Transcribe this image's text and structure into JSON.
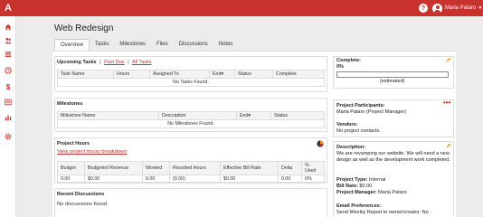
{
  "user": {
    "name": "Maria Pataro"
  },
  "page": {
    "title": "Web Redesign"
  },
  "tabs": [
    {
      "label": "Overview"
    },
    {
      "label": "Tasks"
    },
    {
      "label": "Milestones"
    },
    {
      "label": "Files"
    },
    {
      "label": "Discussions"
    },
    {
      "label": "Notes"
    }
  ],
  "upcoming": {
    "title": "Upcoming Tasks",
    "links": [
      "Past Due",
      "All Tasks"
    ],
    "columns": [
      "Task Name",
      "Hours",
      "Assigned To",
      "End▾",
      "Status",
      "Complete"
    ],
    "empty": "No Tasks Found."
  },
  "milestones": {
    "title": "Milestones",
    "columns": [
      "Milestone Name",
      "Description",
      "End▾",
      "Status"
    ],
    "empty": "No Milestones Found."
  },
  "hours": {
    "title": "Project Hours",
    "link": "View project hours breakdown",
    "columns": [
      "Budget",
      "Budgeted Revenue",
      "Worked",
      "Recoded Hours",
      "Effective Bill Rate",
      "Delta",
      "% Used"
    ],
    "row": [
      "0.00",
      "$0.00",
      "0.00",
      "(0.00)",
      "$0.00",
      "0.00",
      "0%"
    ]
  },
  "discussions": {
    "title": "Recent Discussions",
    "empty": "No discussions found."
  },
  "right": {
    "complete_label": "Complete:",
    "complete_value": "0%",
    "progress_fraction": 0,
    "estimated": "(estimated)",
    "participants_label": "Project Participants:",
    "participants_value": "Maria Pataro (Project Manager)",
    "vendors_label": "Vendors:",
    "vendors_value": "No project contacts.",
    "description_label": "Description:",
    "description_value": "We are revamping our website. We will need a new design as well as the development work completed.",
    "type_label": "Project Type:",
    "type_value": "Internal",
    "bill_label": "Bill Rate:",
    "bill_value": "$0.00",
    "pm_label": "Project Manager:",
    "pm_value": "Maria Pataro",
    "email_label": "Email Preferences:",
    "email_value": "Send Weekly Report to owner/creator: No"
  },
  "colors": {
    "brand": "#c9312c",
    "progress": "#2e7d32",
    "link": "#b33333"
  }
}
